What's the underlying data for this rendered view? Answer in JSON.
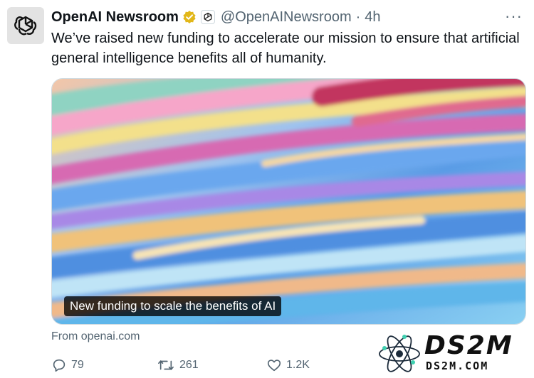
{
  "author": {
    "name": "OpenAI Newsroom",
    "handle": "@OpenAINewsroom",
    "separator": "·",
    "time": "4h",
    "more_label": "···"
  },
  "tweet": {
    "text": "We’ve raised new funding to accelerate our mission to ensure that artificial general intelligence benefits all of humanity."
  },
  "card": {
    "caption": "New funding to scale the benefits of AI",
    "source": "From openai.com"
  },
  "actions": {
    "replies": "79",
    "reposts": "261",
    "likes": "1.2K"
  },
  "watermark": {
    "big": "DS2M",
    "small": "DS2M.COM"
  },
  "colors": {
    "text": "#0f1419",
    "muted": "#536471",
    "verified_gold": "#e2b719",
    "border": "#cfd9de"
  },
  "icons": [
    "openai-logo-icon",
    "verified-badge-icon",
    "affiliate-badge-icon",
    "more-icon",
    "reply-icon",
    "repost-icon",
    "like-icon"
  ]
}
